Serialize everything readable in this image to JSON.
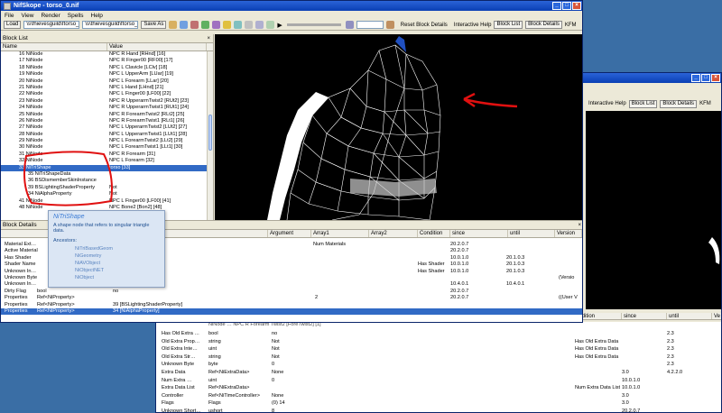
{
  "background_window": {
    "toolbar": {
      "interactive_help": "Interactive Help",
      "block_list": "Block List",
      "block_details": "Block Details",
      "kfm": "KFM"
    },
    "col_headers": [
      "condition",
      "since",
      "until",
      "Ve"
    ],
    "rows": [
      {
        "name": "Has Old Extra …",
        "type": "bool",
        "value": "no",
        "cond": "",
        "since": "",
        "until": "2.3"
      },
      {
        "name": "Old Extra Prop…",
        "type": "string",
        "value": "Not",
        "cond": "Has Old Extra Data",
        "since": "",
        "until": "2.3"
      },
      {
        "name": "Old Extra Inte…",
        "type": "uint",
        "value": "Not",
        "cond": "Has Old Extra Data",
        "since": "",
        "until": "2.3"
      },
      {
        "name": "Old Extra Str…",
        "type": "string",
        "value": "Not",
        "cond": "Has Old Extra Data",
        "since": "",
        "until": "2.3"
      },
      {
        "name": "Unknown Byte",
        "type": "byte",
        "value": "0",
        "cond": "",
        "since": "",
        "until": "2.3"
      },
      {
        "name": "Extra Data",
        "type": "Ref<NiExtraData>",
        "value": "None",
        "cond": "",
        "since": "3.0",
        "until": "4.2.2.0"
      },
      {
        "name": "Num Extra …",
        "type": "uint",
        "value": "0",
        "cond": "",
        "since": "10.0.1.0",
        "until": ""
      },
      {
        "name": "Extra Data List",
        "type": "Ref<NiExtraData>",
        "value": "",
        "cond": "Num Extra Data List",
        "since": "10.0.1.0",
        "until": ""
      },
      {
        "name": "Controller",
        "type": "Ref<NiTimeController>",
        "value": "None",
        "cond": "",
        "since": "3.0",
        "until": ""
      },
      {
        "name": "Flags",
        "type": "Flags",
        "value": "(0) 14",
        "cond": "",
        "since": "3.0",
        "until": ""
      },
      {
        "name": "Unknown Short…",
        "type": "ushort",
        "value": "8",
        "cond": "",
        "since": "20.2.0.7",
        "until": ""
      }
    ],
    "partial_top_row": "NiNode … NPC R Forearm Twist2 [ForeTwist2] [1]"
  },
  "main_window": {
    "title": "NifSkope - torso_0.nif",
    "menu": [
      "File",
      "View",
      "Render",
      "Spells",
      "Help"
    ],
    "toolbar": {
      "load": "Load",
      "load_path": "\\s\\fhievesguild\\ftorso_0.nif",
      "save_path": "\\s\\thievesguild\\ftorso_0.nif",
      "save_as": "Save As",
      "reset_block_details": "Reset Block Details",
      "interactive_help": "Interactive Help",
      "block_list": "Block List",
      "block_details": "Block Details",
      "kfm": "KFM"
    },
    "block_list": {
      "header": "Block List",
      "col_name": "Name",
      "col_value": "Value",
      "rows": [
        {
          "name": "16 NiNode",
          "value": "NPC R Hand [RHnd] [16]"
        },
        {
          "name": "17 NiNode",
          "value": "NPC R Finger00 [RF00] [17]"
        },
        {
          "name": "18 NiNode",
          "value": "NPC L Clavicle [LClv] [18]"
        },
        {
          "name": "19 NiNode",
          "value": "NPC L UpperArm [LUar] [19]"
        },
        {
          "name": "20 NiNode",
          "value": "NPC L Forearm [LLar] [20]"
        },
        {
          "name": "21 NiNode",
          "value": "NPC L Hand [LHnd] [21]"
        },
        {
          "name": "22 NiNode",
          "value": "NPC L Finger00 [LF00] [22]"
        },
        {
          "name": "23 NiNode",
          "value": "NPC R UpperarmTwist2 [RUt2] [23]"
        },
        {
          "name": "24 NiNode",
          "value": "NPC R UpperarmTwist1 [RUt1] [24]"
        },
        {
          "name": "25 NiNode",
          "value": "NPC R ForearmTwist2 [RLt2] [25]"
        },
        {
          "name": "26 NiNode",
          "value": "NPC R ForearmTwist1 [RLt1] [26]"
        },
        {
          "name": "27 NiNode",
          "value": "NPC L UpperarmTwist2 [LUt2] [27]"
        },
        {
          "name": "28 NiNode",
          "value": "NPC L UpperarmTwist1 [LUt1] [28]"
        },
        {
          "name": "29 NiNode",
          "value": "NPC L ForearmTwist2 [LLt2] [29]"
        },
        {
          "name": "30 NiNode",
          "value": "NPC L ForearmTwist1 [LLt1] [30]"
        },
        {
          "name": "31 NiNode",
          "value": "NPC R Forearm [31]"
        },
        {
          "name": "32 NiNode",
          "value": "NPC L Forearm [32]"
        },
        {
          "name": "33 NiTriShape",
          "value": "torso [33]",
          "selected": true
        },
        {
          "name": "35 NiTriShapeData",
          "value": "",
          "indent": 1
        },
        {
          "name": "36 BSDismemberSkinInstance",
          "value": "",
          "indent": 1
        },
        {
          "name": "39 BSLightingShaderProperty",
          "value": "Not",
          "indent": 1
        },
        {
          "name": "34 NiAlphaProperty",
          "value": "Not",
          "indent": 1
        },
        {
          "name": "41 NiNode",
          "value": "NPC L Finger00 [LF00] [41]"
        },
        {
          "name": "48 NiNode",
          "value": "NPC Bone2 [Bon2] [48]"
        }
      ]
    },
    "block_details": {
      "header": "Block Details",
      "cols": [
        "Argument",
        "Array1",
        "Array2",
        "Condition",
        "since",
        "until",
        "Version"
      ],
      "rows": [
        {
          "name": "Material Ext…",
          "type": "",
          "value": "",
          "arg": "",
          "arr1": "Num Materials",
          "cond": "",
          "since": "20.2.0.7",
          "until": ""
        },
        {
          "name": "Active Material",
          "type": "",
          "value": "",
          "arg": "",
          "arr1": "",
          "cond": "",
          "since": "20.2.0.7",
          "until": ""
        },
        {
          "name": "Has Shader",
          "type": "",
          "value": "",
          "arg": "",
          "arr1": "",
          "cond": "",
          "since": "10.0.1.0",
          "until": "20.1.0.3"
        },
        {
          "name": "Shader Name",
          "type": "",
          "value": "",
          "arg": "",
          "arr1": "",
          "cond": "Has Shader",
          "since": "10.0.1.0",
          "until": "20.1.0.3"
        },
        {
          "name": "Unknown In…",
          "type": "",
          "value": "",
          "arg": "",
          "arr1": "",
          "cond": "Has Shader",
          "since": "10.0.1.0",
          "until": "20.1.0.3"
        },
        {
          "name": "Unknown Byte",
          "type": "",
          "value": "",
          "arg": "",
          "arr1": "",
          "cond": "",
          "since": "",
          "until": "",
          "ver": "(Versio"
        },
        {
          "name": "Unknown In…",
          "type": "",
          "value": "",
          "arg": "",
          "arr1": "",
          "cond": "",
          "since": "10.4.0.1",
          "until": "10.4.0.1"
        },
        {
          "name": "Dirty Flag",
          "type": "bool",
          "value": "no",
          "arg": "",
          "arr1": "",
          "cond": "",
          "since": "20.2.0.7",
          "until": ""
        },
        {
          "name": "Properties",
          "type": "Ref<NiProperty>",
          "value": "",
          "arg": "2",
          "arr1": "",
          "cond": "",
          "since": "20.2.0.7",
          "until": "",
          "ver": "((User V"
        },
        {
          "name": "Properties",
          "type": "Ref<NiProperty>",
          "value": "39 [BSLightingShaderProperty]",
          "arg": "",
          "arr1": "",
          "cond": "",
          "since": "",
          "until": ""
        },
        {
          "name": "Properties",
          "type": "Ref<NiProperty>",
          "value": "34 [NiAlphaProperty]",
          "arg": "",
          "arr1": "",
          "cond": "",
          "since": "",
          "until": "",
          "selected": true
        }
      ]
    },
    "tooltip": {
      "title": "NiTriShape",
      "description": "A shape node that refers to singular triangle data.",
      "ancestors_label": "Ancestors:",
      "ancestors": [
        "NiTriBasedGeom",
        "NiGeometry",
        "NiAVObject",
        "NiObjectNET",
        "NiObject"
      ]
    }
  },
  "colors": {
    "desktop": "#3a6ea5",
    "selection": "#316ac5",
    "annotation_red": "#e01010",
    "mesh": "#ffffff",
    "viewport_bg": "#000000"
  }
}
